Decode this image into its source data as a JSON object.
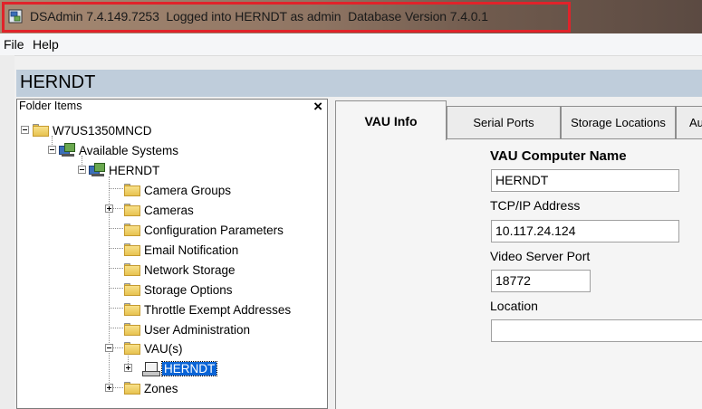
{
  "window": {
    "title": "DSAdmin 7.4.149.7253  Logged into HERNDT as admin  Database Version 7.4.0.1"
  },
  "menu": {
    "items": [
      "File",
      "Help"
    ]
  },
  "header": {
    "title": "HERNDT"
  },
  "folder_panel": {
    "title": "Folder Items",
    "close_label": "×",
    "tree": {
      "root": "W7US1350MNCD",
      "available_systems": "Available Systems",
      "system": "HERNDT",
      "children": [
        "Camera Groups",
        "Cameras",
        "Configuration Parameters",
        "Email Notification",
        "Network Storage",
        "Storage Options",
        "Throttle Exempt Addresses",
        "User Administration",
        "VAU(s)",
        "Zones"
      ],
      "vau_child": "HERNDT"
    }
  },
  "tabs": [
    "VAU Info",
    "Serial Ports",
    "Storage Locations",
    "Au"
  ],
  "vau_info": {
    "computer_name_label": "VAU Computer Name",
    "computer_name_value": "HERNDT",
    "ip_label": "TCP/IP Address",
    "ip_value": "10.117.24.124",
    "port_label": "Video Server Port",
    "port_value": "18772",
    "location_label": "Location",
    "location_value": ""
  },
  "colors": {
    "highlight_border": "#e0232a",
    "header_band": "#bfcddb",
    "selection": "#0a64d6"
  }
}
